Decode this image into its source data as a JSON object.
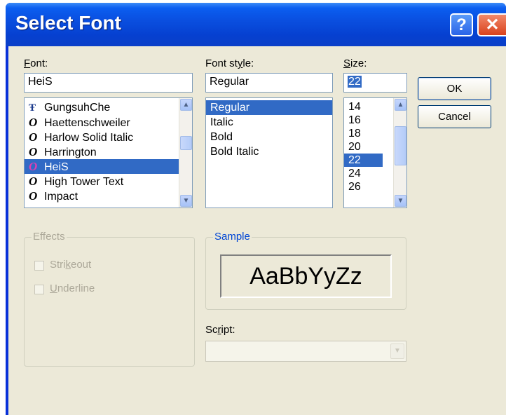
{
  "window": {
    "title": "Select Font",
    "help_label": "?",
    "close_label": "✕"
  },
  "font": {
    "label_underlined": "F",
    "label_rest": "ont:",
    "value": "HeiS",
    "items": [
      {
        "name": "GungsuhChe",
        "icon": "TT"
      },
      {
        "name": "Haettenschweiler",
        "icon": "O"
      },
      {
        "name": "Harlow Solid Italic",
        "icon": "O"
      },
      {
        "name": "Harrington",
        "icon": "O"
      },
      {
        "name": "HeiS",
        "icon": "O"
      },
      {
        "name": "High Tower Text",
        "icon": "O"
      },
      {
        "name": "Impact",
        "icon": "O"
      }
    ]
  },
  "style": {
    "label_pre": "Font st",
    "label_underlined": "y",
    "label_rest": "le:",
    "value": "Regular",
    "items": [
      "Regular",
      "Italic",
      "Bold",
      "Bold Italic"
    ]
  },
  "size": {
    "label_underlined": "S",
    "label_rest": "ize:",
    "value": "22",
    "items": [
      "14",
      "16",
      "18",
      "20",
      "22",
      "24",
      "26"
    ]
  },
  "buttons": {
    "ok": "OK",
    "cancel": "Cancel"
  },
  "effects": {
    "title": "Effects",
    "strikeout_pre": "Stri",
    "strikeout_u": "k",
    "strikeout_rest": "eout",
    "underline_u": "U",
    "underline_rest": "nderline"
  },
  "sample": {
    "title": "Sample",
    "text": "AaBbYyZz"
  },
  "script": {
    "label_pre": "Sc",
    "label_u": "r",
    "label_rest": "ipt:",
    "value": ""
  },
  "colors": {
    "title_bar": "#0a4fe0",
    "selection": "#316ac5",
    "dialog_bg": "#ece9d8",
    "disabled_text": "#aca899"
  }
}
